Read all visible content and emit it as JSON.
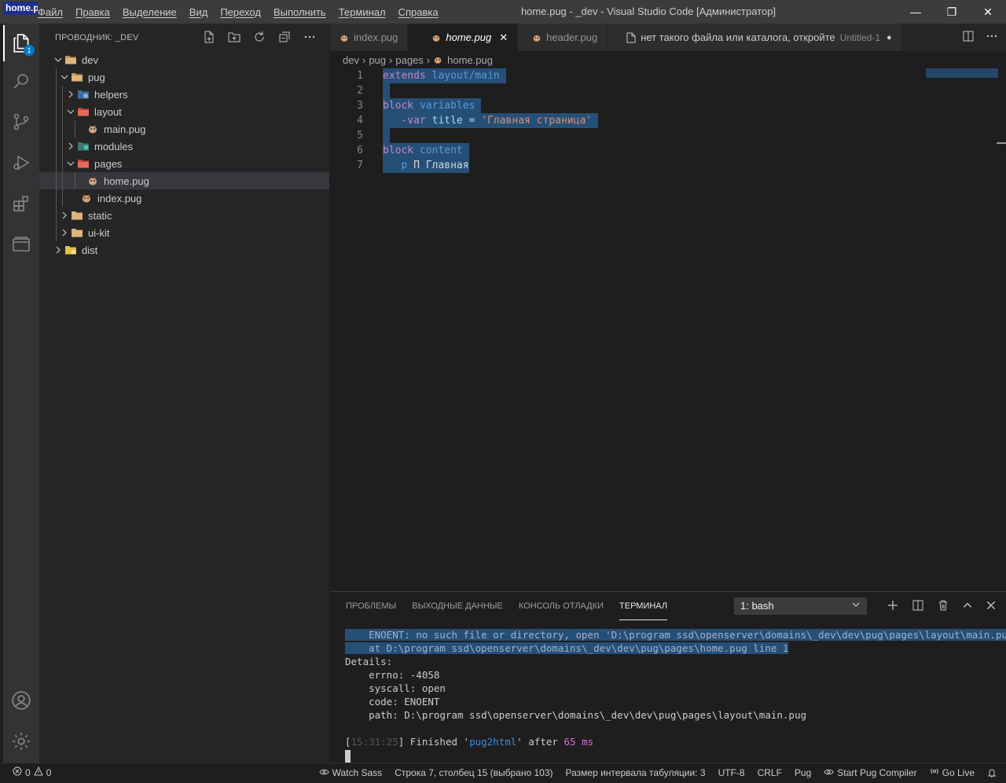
{
  "titlebar": {
    "app_label": "home.pug",
    "menu": [
      "Файл",
      "Правка",
      "Выделение",
      "Вид",
      "Переход",
      "Выполнить",
      "Терминал",
      "Справка"
    ],
    "title": "home.pug - _dev - Visual Studio Code [Администратор]",
    "minimize": "—",
    "restore": "❐",
    "close": "✕"
  },
  "activity": {
    "explorer_badge": "1"
  },
  "explorer": {
    "header": "ПРОВОДНИК: _DEV",
    "tree": [
      {
        "label": "dev",
        "type": "folder",
        "expanded": true
      },
      {
        "label": "pug",
        "type": "folder",
        "expanded": true
      },
      {
        "label": "helpers",
        "type": "folder",
        "expanded": false
      },
      {
        "label": "layout",
        "type": "folder",
        "expanded": true
      },
      {
        "label": "main.pug",
        "type": "file"
      },
      {
        "label": "modules",
        "type": "folder",
        "expanded": false
      },
      {
        "label": "pages",
        "type": "folder",
        "expanded": true
      },
      {
        "label": "home.pug",
        "type": "file",
        "selected": true
      },
      {
        "label": "index.pug",
        "type": "file"
      },
      {
        "label": "static",
        "type": "folder",
        "expanded": false
      },
      {
        "label": "ui-kit",
        "type": "folder",
        "expanded": false
      },
      {
        "label": "dist",
        "type": "folder",
        "expanded": false
      }
    ]
  },
  "tabs": [
    {
      "label": "index.pug"
    },
    {
      "label": "home.pug",
      "active": true,
      "close": "✕"
    },
    {
      "label": "header.pug"
    },
    {
      "label": "нет такого файла или каталога, откройте",
      "extra": "Untitled-1",
      "dirty": "●"
    }
  ],
  "breadcrumb": [
    "dev",
    "pug",
    "pages",
    "home.pug"
  ],
  "code": {
    "line_numbers": [
      "1",
      "2",
      "3",
      "4",
      "5",
      "6",
      "7"
    ],
    "l1_kw": "extends",
    "l1_rest": " layout/main",
    "l3_kw": "block",
    "l3_rest": " variables",
    "l4_kw": "-var",
    "l4_var": " title",
    "l4_eq": " = ",
    "l4_str": "'Главная страница'",
    "l6_kw": "block",
    "l6_rest": " content",
    "l7_tag": "p",
    "l7_text": " П Главная"
  },
  "panel": {
    "tabs": [
      "ПРОБЛЕМЫ",
      "ВЫХОДНЫЕ ДАННЫЕ",
      "КОНСОЛЬ ОТЛАДКИ",
      "ТЕРМИНАЛ"
    ],
    "terminal_select": "1: bash",
    "terminal": {
      "err1": "    ENOENT: no such file or directory, open 'D:\\program ssd\\openserver\\domains\\_dev\\dev\\pug\\pages\\layout\\main.pug'",
      "err2": "    at D:\\program ssd\\openserver\\domains\\_dev\\dev\\pug\\pages\\home.pug line 1",
      "details": "Details:",
      "errno": "    errno: -4058",
      "syscall": "    syscall: open",
      "code": "    code: ENOENT",
      "path": "    path: D:\\program ssd\\openserver\\domains\\_dev\\dev\\pug\\pages\\layout\\main.pug",
      "time": "15:31:25",
      "finished": "] Finished '",
      "task": "pug2html",
      "after": "' after ",
      "duration": "65 ms"
    }
  },
  "statusbar": {
    "errors": "0",
    "warnings": "0",
    "watch_sass": "Watch Sass",
    "position": "Строка 7, столбец 15 (выбрано 103)",
    "indent": "Размер интервала табуляции: 3",
    "encoding": "UTF-8",
    "eol": "CRLF",
    "language": "Pug",
    "pug_compiler": "Start Pug Compiler",
    "go_live": "Go Live"
  },
  "colors": {
    "accent": "#007acc",
    "selection": "#264f78",
    "keyword": "#c586c0",
    "tag": "#569cd6",
    "string": "#ce9178"
  }
}
